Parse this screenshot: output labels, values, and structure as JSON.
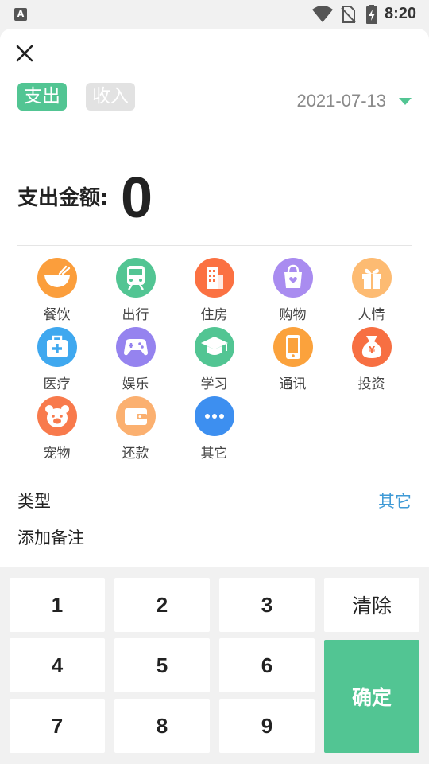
{
  "status_bar": {
    "app_badge": "A",
    "time": "8:20"
  },
  "header": {
    "tabs": [
      {
        "label": "支出",
        "active": true
      },
      {
        "label": "收入",
        "active": false
      }
    ],
    "date": "2021-07-13"
  },
  "amount": {
    "label": "支出金额:",
    "value": "0"
  },
  "categories": [
    {
      "label": "餐饮",
      "icon": "bowl-icon",
      "color": "#fb9e3c"
    },
    {
      "label": "出行",
      "icon": "train-icon",
      "color": "#52c593"
    },
    {
      "label": "住房",
      "icon": "building-icon",
      "color": "#fb7142"
    },
    {
      "label": "购物",
      "icon": "shopping-bag-icon",
      "color": "#a98cf0"
    },
    {
      "label": "人情",
      "icon": "gift-icon",
      "color": "#fdbb72"
    },
    {
      "label": "医疗",
      "icon": "medical-kit-icon",
      "color": "#3fa8ef"
    },
    {
      "label": "娱乐",
      "icon": "gamepad-icon",
      "color": "#9583ef"
    },
    {
      "label": "学习",
      "icon": "graduation-cap-icon",
      "color": "#52c593"
    },
    {
      "label": "通讯",
      "icon": "phone-icon",
      "color": "#fba23c"
    },
    {
      "label": "投资",
      "icon": "money-bag-icon",
      "color": "#f76f42"
    },
    {
      "label": "宠物",
      "icon": "pet-icon",
      "color": "#f87a4c"
    },
    {
      "label": "还款",
      "icon": "wallet-icon",
      "color": "#fbb070"
    },
    {
      "label": "其它",
      "icon": "more-icon",
      "color": "#3d8ff0"
    }
  ],
  "type_row": {
    "label": "类型",
    "value": "其它"
  },
  "note": {
    "placeholder": "添加备注"
  },
  "keypad": {
    "digits": [
      "1",
      "2",
      "3",
      "4",
      "5",
      "6",
      "7",
      "8",
      "9"
    ],
    "clear": "清除",
    "confirm": "确定"
  },
  "colors": {
    "accent": "#52c593",
    "link": "#3f9ad6",
    "muted": "#8a8a8a"
  }
}
